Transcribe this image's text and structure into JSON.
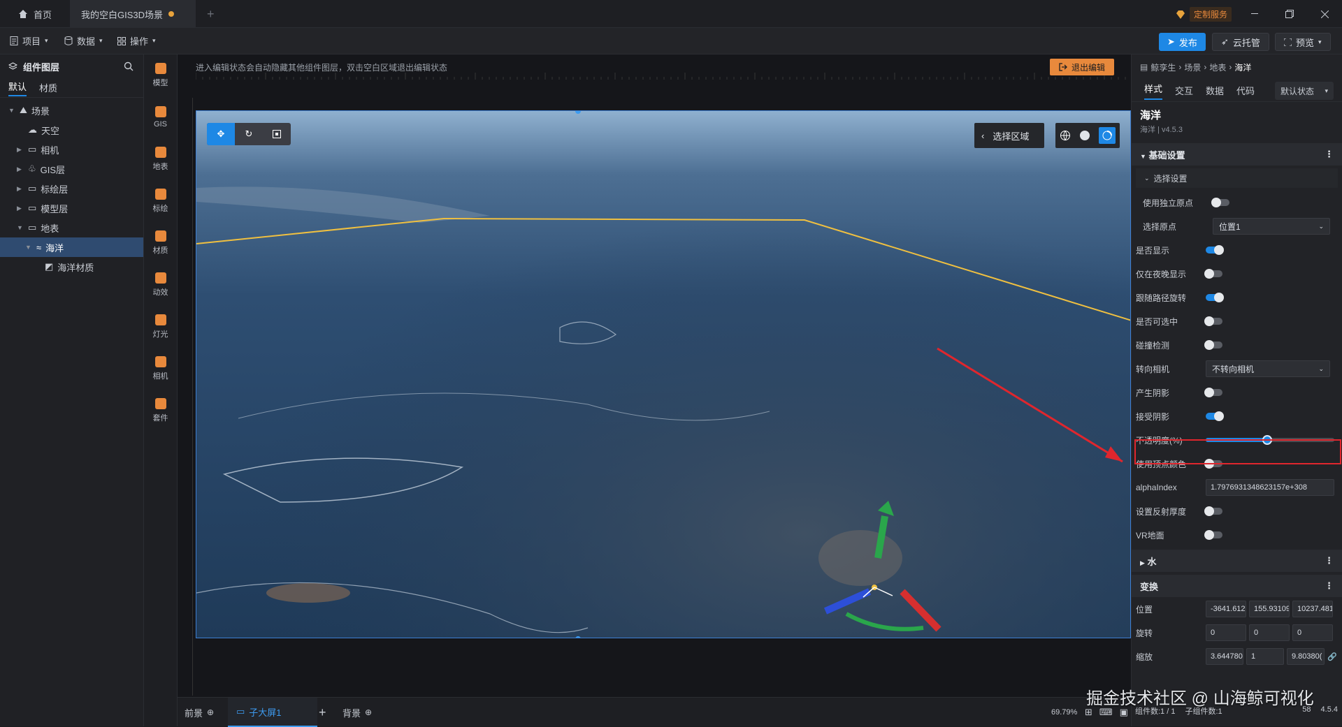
{
  "tabs": [
    {
      "label": "首页",
      "active": false
    },
    {
      "label": "我的空白GIS3D场景",
      "active": true,
      "modified": true
    }
  ],
  "titlebar": {
    "custom_service": "定制服务"
  },
  "toolbar": {
    "menus": [
      "项目",
      "数据",
      "操作"
    ],
    "publish": "发布",
    "cloud": "云托管",
    "preview": "预览"
  },
  "left_panel": {
    "title": "组件图层",
    "tabs": [
      "默认",
      "材质"
    ],
    "tree": [
      {
        "label": "场景",
        "depth": 0,
        "expanded": true,
        "icon": "scene-icon"
      },
      {
        "label": "天空",
        "depth": 1,
        "icon": "sky-icon"
      },
      {
        "label": "相机",
        "depth": 1,
        "collapsed": true,
        "icon": "folder-icon"
      },
      {
        "label": "GIS层",
        "depth": 1,
        "collapsed": true,
        "icon": "gis-icon"
      },
      {
        "label": "标绘层",
        "depth": 1,
        "collapsed": true,
        "icon": "folder-icon"
      },
      {
        "label": "模型层",
        "depth": 1,
        "collapsed": true,
        "icon": "folder-icon"
      },
      {
        "label": "地表",
        "depth": 1,
        "expanded": true,
        "icon": "folder-icon"
      },
      {
        "label": "海洋",
        "depth": 2,
        "expanded": true,
        "selected": true,
        "icon": "ocean-icon"
      },
      {
        "label": "海洋材质",
        "depth": 3,
        "icon": "material-icon"
      }
    ]
  },
  "icon_rail": [
    {
      "label": "模型",
      "color": "#e8893c"
    },
    {
      "label": "GIS",
      "color": "#e8893c"
    },
    {
      "label": "地表",
      "color": "#e8893c"
    },
    {
      "label": "标绘",
      "color": "#e8893c"
    },
    {
      "label": "材质",
      "color": "#e8893c"
    },
    {
      "label": "动效",
      "color": "#e8893c"
    },
    {
      "label": "灯光",
      "color": "#e8893c"
    },
    {
      "label": "相机",
      "color": "#e8893c"
    },
    {
      "label": "套件",
      "color": "#e8893c"
    }
  ],
  "canvas": {
    "hint": "进入编辑状态会自动隐藏其他组件图层，双击空白区域退出编辑状态",
    "exit_edit": "退出编辑",
    "select_region": "选择区域"
  },
  "bottom": {
    "tabs": [
      "前景",
      "子大屏1",
      "背景"
    ],
    "zoom": "69.79%"
  },
  "right_panel": {
    "breadcrumb": [
      "鲸孪生",
      "场景",
      "地表",
      "海洋"
    ],
    "tabs": [
      "样式",
      "交互",
      "数据",
      "代码"
    ],
    "state": "默认状态",
    "component_name": "海洋",
    "component_version": "海洋 | v4.5.3",
    "section_basic": "基础设置",
    "subsection_select": "选择设置",
    "use_origin_label": "使用独立原点",
    "origin_label": "选择原点",
    "origin_value": "位置1",
    "props": [
      {
        "label": "是否显示",
        "on": true
      },
      {
        "label": "仅在夜晚显示",
        "on": false
      },
      {
        "label": "跟随路径旋转",
        "on": true
      },
      {
        "label": "是否可选中",
        "on": false
      },
      {
        "label": "碰撞检测",
        "on": false
      }
    ],
    "face_camera_label": "转向相机",
    "face_camera_value": "不转向相机",
    "cast_shadow_label": "产生阴影",
    "receive_shadow_label": "接受阴影",
    "opacity_label": "不透明度(%)",
    "opacity_value": 0.48,
    "vertex_color_label": "使用顶点颜色",
    "alpha_index_label": "alphaIndex",
    "alpha_index_value": "1.7976931348623157e+308",
    "reflect_label": "设置反射厚度",
    "vr_label": "VR地面",
    "section_water": "水",
    "section_transform": "变换",
    "position_label": "位置",
    "position": [
      "-3641.612:",
      "155.93109'",
      "10237.481("
    ],
    "rotation_label": "旋转",
    "rotation": [
      "0",
      "0",
      "0"
    ],
    "scale_label": "缩放",
    "scale": [
      "3.644780",
      "1",
      "9.80380("
    ]
  },
  "status": {
    "components": "组件数:1 / 1",
    "children": "子组件数:1",
    "fps": "58",
    "version": "4.5.4"
  },
  "watermark": "掘金技术社区 @ 山海鲸可视化",
  "colors": {
    "accent": "#1e88e5",
    "orange": "#e8893c",
    "highlight": "#e0262d",
    "bg": "#1b1c1f"
  }
}
